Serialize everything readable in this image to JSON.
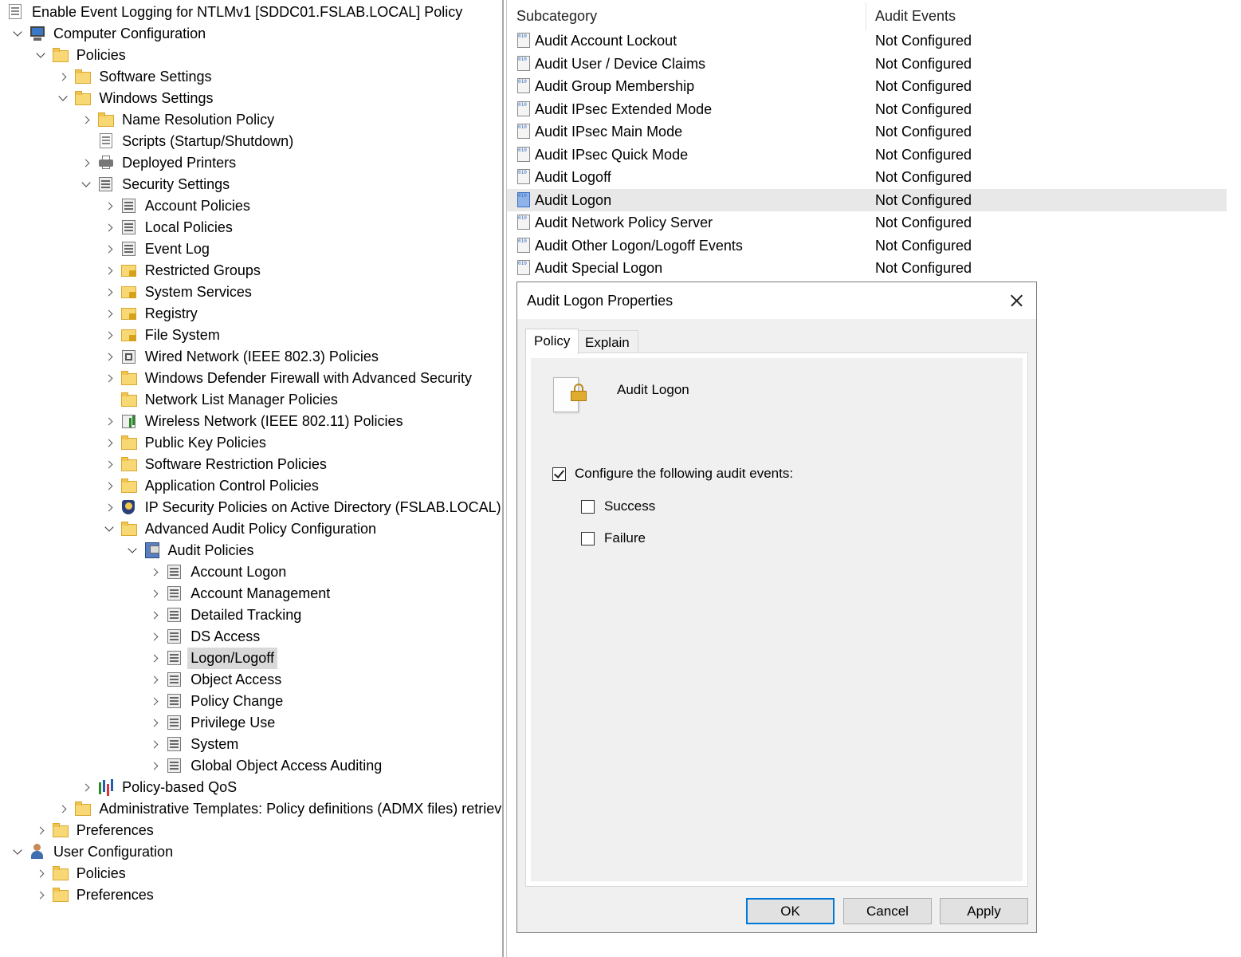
{
  "tree": {
    "root_title": "Enable Event Logging for NTLMv1 [SDDC01.FSLAB.LOCAL] Policy",
    "items": [
      {
        "label": "Computer Configuration",
        "icon": "computer-icon"
      },
      {
        "label": "Policies",
        "icon": "folder-icon"
      },
      {
        "label": "Software Settings",
        "icon": "folder-icon"
      },
      {
        "label": "Windows Settings",
        "icon": "folder-icon"
      },
      {
        "label": "Name Resolution Policy",
        "icon": "folder-icon"
      },
      {
        "label": "Scripts (Startup/Shutdown)",
        "icon": "script-icon"
      },
      {
        "label": "Deployed Printers",
        "icon": "printer-icon"
      },
      {
        "label": "Security Settings",
        "icon": "security-icon"
      },
      {
        "label": "Account Policies",
        "icon": "policy-icon"
      },
      {
        "label": "Local Policies",
        "icon": "policy-icon"
      },
      {
        "label": "Event Log",
        "icon": "policy-icon"
      },
      {
        "label": "Restricted Groups",
        "icon": "locked-folder-icon"
      },
      {
        "label": "System Services",
        "icon": "locked-folder-icon"
      },
      {
        "label": "Registry",
        "icon": "locked-folder-icon"
      },
      {
        "label": "File System",
        "icon": "locked-folder-icon"
      },
      {
        "label": "Wired Network (IEEE 802.3) Policies",
        "icon": "wired-network-icon"
      },
      {
        "label": "Windows Defender Firewall with Advanced Security",
        "icon": "folder-icon"
      },
      {
        "label": "Network List Manager Policies",
        "icon": "folder-icon"
      },
      {
        "label": "Wireless Network (IEEE 802.11) Policies",
        "icon": "wireless-network-icon"
      },
      {
        "label": "Public Key Policies",
        "icon": "folder-icon"
      },
      {
        "label": "Software Restriction Policies",
        "icon": "folder-icon"
      },
      {
        "label": "Application Control Policies",
        "icon": "folder-icon"
      },
      {
        "label": "IP Security Policies on Active Directory (FSLAB.LOCAL)",
        "icon": "ip-security-icon"
      },
      {
        "label": "Advanced Audit Policy Configuration",
        "icon": "folder-icon"
      },
      {
        "label": "Audit Policies",
        "icon": "audit-policies-icon"
      },
      {
        "label": "Account Logon",
        "icon": "policy-icon"
      },
      {
        "label": "Account Management",
        "icon": "policy-icon"
      },
      {
        "label": "Detailed Tracking",
        "icon": "policy-icon"
      },
      {
        "label": "DS Access",
        "icon": "policy-icon"
      },
      {
        "label": "Logon/Logoff",
        "icon": "policy-icon"
      },
      {
        "label": "Object Access",
        "icon": "policy-icon"
      },
      {
        "label": "Policy Change",
        "icon": "policy-icon"
      },
      {
        "label": "Privilege Use",
        "icon": "policy-icon"
      },
      {
        "label": "System",
        "icon": "policy-icon"
      },
      {
        "label": "Global Object Access Auditing",
        "icon": "policy-icon"
      },
      {
        "label": "Policy-based QoS",
        "icon": "qos-chart-icon"
      },
      {
        "label": "Administrative Templates: Policy definitions (ADMX files) retrieved",
        "icon": "folder-icon"
      },
      {
        "label": "Preferences",
        "icon": "folder-icon"
      },
      {
        "label": "User Configuration",
        "icon": "user-icon"
      },
      {
        "label": "Policies",
        "icon": "folder-icon"
      },
      {
        "label": "Preferences",
        "icon": "folder-icon"
      }
    ]
  },
  "list": {
    "col_subcategory": "Subcategory",
    "col_audit_events": "Audit Events",
    "rows": [
      {
        "subcategory": "Audit Account Lockout",
        "events": "Not Configured"
      },
      {
        "subcategory": "Audit User / Device Claims",
        "events": "Not Configured"
      },
      {
        "subcategory": "Audit Group Membership",
        "events": "Not Configured"
      },
      {
        "subcategory": "Audit IPsec Extended Mode",
        "events": "Not Configured"
      },
      {
        "subcategory": "Audit IPsec Main Mode",
        "events": "Not Configured"
      },
      {
        "subcategory": "Audit IPsec Quick Mode",
        "events": "Not Configured"
      },
      {
        "subcategory": "Audit Logoff",
        "events": "Not Configured"
      },
      {
        "subcategory": "Audit Logon",
        "events": "Not Configured"
      },
      {
        "subcategory": "Audit Network Policy Server",
        "events": "Not Configured"
      },
      {
        "subcategory": "Audit Other Logon/Logoff Events",
        "events": "Not Configured"
      },
      {
        "subcategory": "Audit Special Logon",
        "events": "Not Configured"
      }
    ]
  },
  "dialog": {
    "title": "Audit Logon Properties",
    "tab_policy": "Policy",
    "tab_explain": "Explain",
    "policy_name": "Audit Logon",
    "configure_label": "Configure the following audit events:",
    "configure_checked": true,
    "success_label": "Success",
    "success_checked": false,
    "failure_label": "Failure",
    "failure_checked": false,
    "ok": "OK",
    "cancel": "Cancel",
    "apply": "Apply"
  },
  "colors": {
    "accent": "#0078d7",
    "selection": "#d9d9d9",
    "dialog_bg": "#f0f0f0"
  }
}
